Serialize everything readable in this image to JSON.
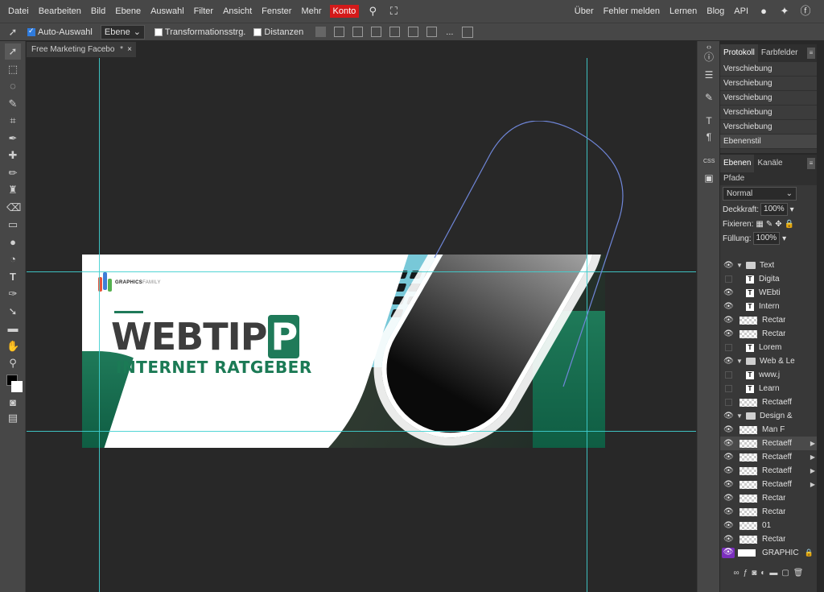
{
  "menu": {
    "items": [
      "Datei",
      "Bearbeiten",
      "Bild",
      "Ebene",
      "Auswahl",
      "Filter",
      "Ansicht",
      "Fenster",
      "Mehr"
    ],
    "account": "Konto",
    "right_items": [
      "Über",
      "Fehler melden",
      "Lernen",
      "Blog",
      "API"
    ]
  },
  "options": {
    "auto_select_label": "Auto-Auswahl",
    "auto_select_checked": true,
    "target_select": "Ebene",
    "transform_label": "Transformationsstrg.",
    "distance_label": "Distanzen",
    "more_label": "..."
  },
  "document": {
    "tab_title": "Free Marketing Facebo",
    "modified_marker": "*",
    "close_label": "×"
  },
  "banner": {
    "logo_text_bold": "GRAPHICS",
    "logo_text_light": "FAMILY",
    "headline": "WEBTIP",
    "headline_accent": "P",
    "subline": "INTERNET RATGEBER"
  },
  "panels": {
    "history_tabs": [
      "Protokoll",
      "Farbfelder"
    ],
    "history": [
      "Verschiebung",
      "Verschiebung",
      "Verschiebung",
      "Verschiebung",
      "Verschiebung",
      "Ebenenstil"
    ],
    "layer_tabs": [
      "Ebenen",
      "Kanäle",
      "Pfade"
    ],
    "blend_mode": "Normal",
    "opacity_label": "Deckkraft:",
    "opacity_value": "100%",
    "lock_label": "Fixieren:",
    "fill_label": "Füllung:",
    "fill_value": "100%"
  },
  "layers": [
    {
      "type": "folder",
      "name": "Text",
      "visible": true
    },
    {
      "type": "text",
      "name": "Digita",
      "visible": false
    },
    {
      "type": "text",
      "name": "WEbti",
      "visible": true
    },
    {
      "type": "text",
      "name": "Intern",
      "visible": true
    },
    {
      "type": "image",
      "name": "Rectar",
      "visible": true
    },
    {
      "type": "image",
      "name": "Rectar",
      "visible": true
    },
    {
      "type": "text",
      "name": "Lorem",
      "visible": false
    },
    {
      "type": "folder",
      "name": "Web & Le",
      "visible": true
    },
    {
      "type": "text",
      "name": "www.j",
      "visible": false
    },
    {
      "type": "text",
      "name": "Learn",
      "visible": false
    },
    {
      "type": "image",
      "name": "Rectaeff",
      "visible": false
    },
    {
      "type": "folder",
      "name": "Design &",
      "visible": true
    },
    {
      "type": "image",
      "name": "Man F",
      "visible": true
    },
    {
      "type": "image",
      "name": "Rectaeff",
      "visible": true,
      "selected": true
    },
    {
      "type": "image",
      "name": "Rectaeff",
      "visible": true
    },
    {
      "type": "image",
      "name": "Rectaeff",
      "visible": true
    },
    {
      "type": "image",
      "name": "Rectaeff",
      "visible": true
    },
    {
      "type": "image",
      "name": "Rectar",
      "visible": true
    },
    {
      "type": "image",
      "name": "Rectar",
      "visible": true
    },
    {
      "type": "image",
      "name": "01",
      "visible": true
    },
    {
      "type": "image",
      "name": "Rectar",
      "visible": true
    }
  ],
  "background_layer": {
    "name": "GRAPHIC"
  },
  "colors": {
    "accent_green": "#1f7a59",
    "guide": "#3fd0d0",
    "konto_red": "#d41a1a",
    "path_blue": "#6f86d8"
  }
}
